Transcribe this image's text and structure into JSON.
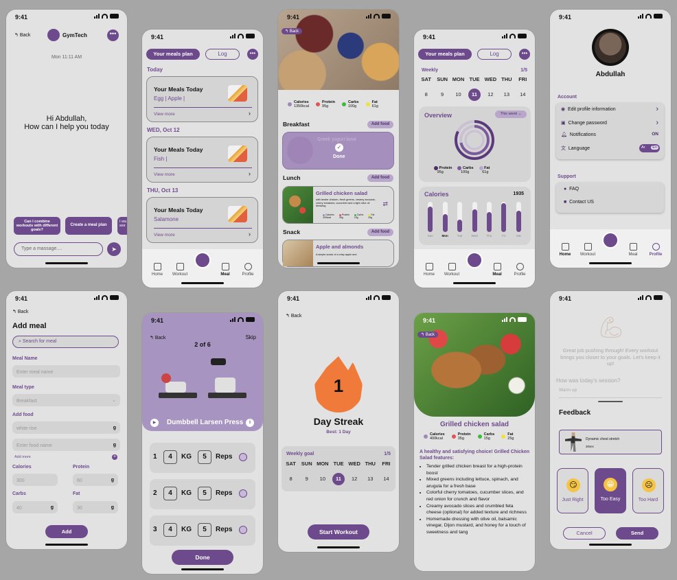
{
  "common": {
    "time": "9:41",
    "back": "Back"
  },
  "s1": {
    "app": "GymTech",
    "date": "Mon 11:11 AM",
    "greet1": "Hi Abdullah,",
    "greet2": "How can I  help you today",
    "chip1": "Can I combine workouts with different goals?",
    "chip2": "Create a meal plan",
    "chip3": "I wa wor",
    "placeholder": "Type a massage...."
  },
  "s2": {
    "tab1": "Your meals plan",
    "tab2": "Log",
    "today": "Today",
    "day2": "WED, Oct 12",
    "day3": "THU, Oct 13",
    "title": "Your Meals Today",
    "m1": "Egg | Apple |",
    "m2": "Fish |",
    "m3": "Salamone",
    "view": "View more"
  },
  "nav": {
    "home": "Home",
    "workout": "Workout",
    "meal": "Meal",
    "profile": "Profile"
  },
  "s3": {
    "cal": "Calories",
    "calv": "1350kcal",
    "pro": "Protein",
    "prov": "95g",
    "carb": "Carbs",
    "carbv": "100g",
    "fat": "Fat",
    "fatv": "61g",
    "breakfast": "Breakfast",
    "add": "Add food",
    "bf_item": "Greek yogurt bowl",
    "done": "Done",
    "lunch": "Lunch",
    "lunch_item": "Grilled chicken salad",
    "lunch_desc": "with tender chicken, fresh greens, creamy avocado, cherry tomatoes, cucumber and a light olive oil dressing",
    "lc": "400kcal",
    "lp": "35g",
    "lcb": "15g",
    "lf": "25g",
    "snack": "Snack",
    "snack_item": "Apple and almonds",
    "snack_desc": "A simple snack of a crisp apple and"
  },
  "s4": {
    "weekly": "Weekly",
    "frac": "1/5",
    "days": [
      "SAT",
      "SUN",
      "MON",
      "TUE",
      "WED",
      "THU",
      "FRI"
    ],
    "dates": [
      "8",
      "9",
      "10",
      "11",
      "12",
      "13",
      "14"
    ],
    "overview": "Overview",
    "week": "This week",
    "calories": "Calories",
    "cval": "1935",
    "bdays": [
      "Sun",
      "Mon",
      "Tue",
      "Wed",
      "Thu",
      "Fri",
      "Sat"
    ],
    "bvals": [
      0.85,
      0.6,
      0.4,
      0.75,
      0.65,
      0.95,
      0.7
    ]
  },
  "s5": {
    "name": "Abdullah",
    "account": "Account",
    "edit": "Edit profile information",
    "pwd": "Change password",
    "notif": "Notifications",
    "on": "ON",
    "lang": "Language",
    "ar": "Ar",
    "en": "En",
    "support": "Support",
    "faq": "FAQ",
    "contact": "Contact US"
  },
  "s6": {
    "title": "Add meal",
    "search": "Search for meal",
    "mname": "Meal Name",
    "mname_ph": "Enter meal name",
    "mtype": "Meal type",
    "mtype_v": "Breakfast",
    "addfood": "Add food",
    "f1": "white rise",
    "g": "g",
    "fname_ph": "Enter food name",
    "addmore": "Add more",
    "calories": "Calories",
    "calv": "300",
    "protein": "Protein",
    "protv": "60",
    "carbs": "Carbs",
    "carbv": "40",
    "fat": "Fat",
    "fatv": "30",
    "btn": "Add"
  },
  "s7": {
    "skip": "Skip",
    "prog": "2 of 6",
    "ex": "Dumbbell Larsen Press",
    "sets": [
      {
        "n": "1",
        "kg": "4",
        "reps": "5"
      },
      {
        "n": "2",
        "kg": "4",
        "reps": "5"
      },
      {
        "n": "3",
        "kg": "4",
        "reps": "5"
      }
    ],
    "kgl": "KG",
    "repsl": "Reps",
    "done": "Done"
  },
  "s8": {
    "streak": "1",
    "title": "Day Streak",
    "best": "Best: 1 Day",
    "goal": "Weekly goal",
    "frac": "1/5",
    "days": [
      "SAT",
      "SUN",
      "MON",
      "TUE",
      "WED",
      "THU",
      "FRI"
    ],
    "dates": [
      "8",
      "9",
      "10",
      "11",
      "12",
      "13",
      "14"
    ],
    "btn": "Start Workout"
  },
  "s9": {
    "title": "Grilled chicken salad",
    "cal": "Calories",
    "calv": "400kcal",
    "pro": "Protein",
    "prov": "35g",
    "carb": "Carbs",
    "carbv": "15g",
    "fat": "Fat",
    "fatv": "25g",
    "intro": "A healthy and satisfying choice! Grilled Chicken Salad features:",
    "b1": "Tender grilled chicken breast for a high-protein boost",
    "b2": "Mixed greens including lettuce, spinach, and arugula for a fresh base",
    "b3": "Colorful cherry tomatoes, cucumber slices, and red onion for crunch and flavor",
    "b4": "Creamy avocado slices and crumbled feta cheese (optional) for added texture and richness",
    "b5": "Homemade dressing with olive oil, balsamic vinegar, Dijon mustard, and honey for a touch of sweetness and tang"
  },
  "s10": {
    "msg": "Great job pushing through! Every workout brings you closer to your goals. Let's keep it up!",
    "q": "How was today's session?",
    "w": "Warm up",
    "fb": "Feedback",
    "ex": "Dynamic chest stretch",
    "sec": "30sec",
    "o1": "Just Right",
    "o2": "Too Easy",
    "o3": "Too Hard",
    "cancel": "Cancel",
    "send": "Send"
  },
  "colors": {
    "accent": "#6d4a8c",
    "protein": "#e05555",
    "carbs": "#3cbb3c",
    "fat": "#f0e23c",
    "calories": "#9d8ab5",
    "flame": "#f07a3a"
  }
}
